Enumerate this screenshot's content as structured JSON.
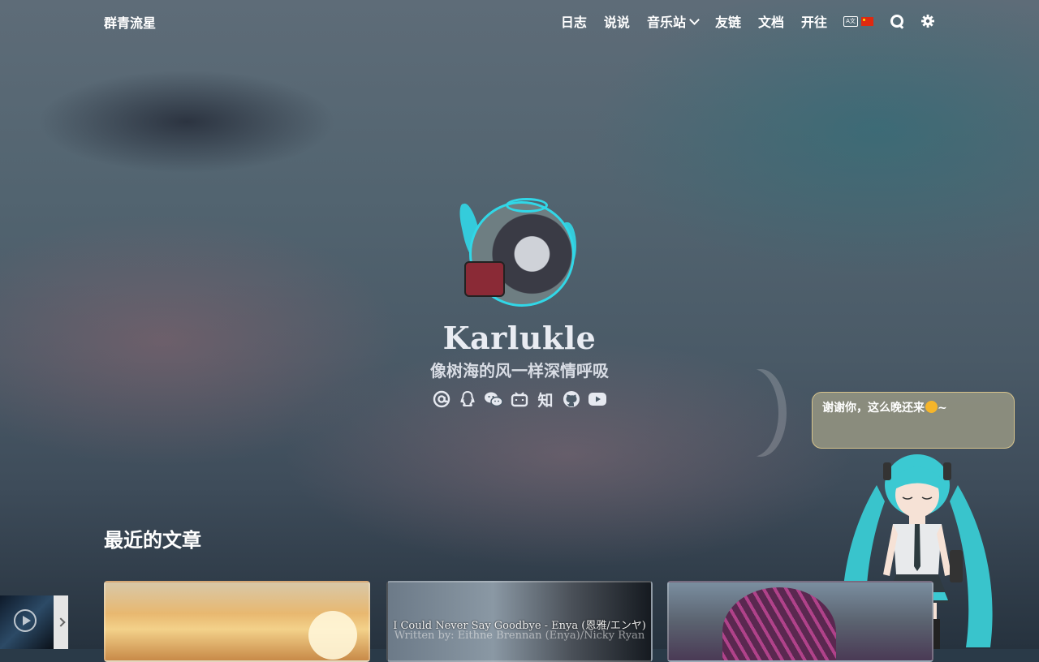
{
  "nav": {
    "brand": "群青流星",
    "items": [
      {
        "label": "日志"
      },
      {
        "label": "说说"
      },
      {
        "label": "音乐站",
        "has_dropdown": true
      },
      {
        "label": "友链"
      },
      {
        "label": "文档"
      },
      {
        "label": "开往"
      }
    ],
    "language_icon": "translate-icon",
    "language_flag": "cn-flag",
    "search_icon": "search-icon",
    "theme_icon": "gear-icon"
  },
  "hero": {
    "name": "Karlukle",
    "motto": "像树海的风一样深情呼吸",
    "socials": [
      {
        "icon": "email-at-icon"
      },
      {
        "icon": "qq-icon"
      },
      {
        "icon": "wechat-icon"
      },
      {
        "icon": "bilibili-icon"
      },
      {
        "icon": "zhihu-icon",
        "glyph": "知"
      },
      {
        "icon": "github-icon"
      },
      {
        "icon": "youtube-icon"
      }
    ]
  },
  "mascot": {
    "speech": "谢谢你，这么晚还来",
    "speech_suffix": "~"
  },
  "recent": {
    "title": "最近的文章",
    "cards": [
      {
        "caption": ""
      },
      {
        "caption": "I Could Never Say Goodbye - Enya (恩雅/エンヤ)",
        "caption2": "Written by:  Eithne Brennan (Enya)/Nicky Ryan"
      },
      {
        "caption": ""
      }
    ]
  },
  "player": {
    "icon": "play-icon"
  },
  "colors": {
    "accent_cyan": "#31d7e7",
    "bubble_border": "#d6c38c"
  }
}
